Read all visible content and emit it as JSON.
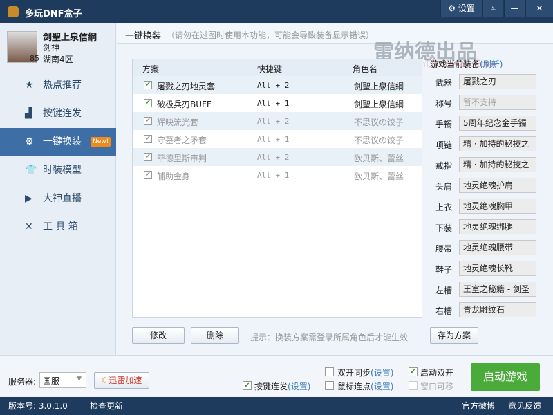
{
  "app": {
    "title": "多玩DNF盒子",
    "settings": "设置"
  },
  "profile": {
    "name": "剑聖上泉信綱",
    "class": "剑神",
    "server": "湖南4区",
    "level": "85"
  },
  "nav": [
    {
      "label": "热点推荐",
      "icon": "★"
    },
    {
      "label": "按键连发",
      "icon": "▟"
    },
    {
      "label": "一键换装",
      "icon": "⚙",
      "badge": "New!"
    },
    {
      "label": "时装模型",
      "icon": "👕"
    },
    {
      "label": "大神直播",
      "icon": "▶"
    },
    {
      "label": "工 具 箱",
      "icon": "✕"
    }
  ],
  "header": {
    "title": "一键换装",
    "note": "（请勿在过图时使用本功能，可能会导致装备显示错误）"
  },
  "watermark": {
    "main": "雷纳德出品",
    "url": "Dnf.Ddowan.Com"
  },
  "table": {
    "headers": [
      "方案",
      "快捷键",
      "角色名"
    ],
    "rows": [
      {
        "name": "屠戮之刃地灵套",
        "key": "Alt + 2",
        "role": "剑聖上泉信綱"
      },
      {
        "name": "破极兵刃BUFF",
        "key": "Alt + 1",
        "role": "剑聖上泉信綱"
      },
      {
        "name": "辉映流光套",
        "key": "Alt + 2",
        "role": "不思议の饺子"
      },
      {
        "name": "守墓者之矛套",
        "key": "Alt + 1",
        "role": "不思议の饺子"
      },
      {
        "name": "菲德里斯审判",
        "key": "Alt + 2",
        "role": "欧贝斯、蕾丝"
      },
      {
        "name": "辅助金身",
        "key": "Alt + 1",
        "role": "欧贝斯、蕾丝"
      }
    ]
  },
  "actions": {
    "edit": "修改",
    "delete": "删除",
    "tip": "提示：换装方案需登录所属角色后才能生效",
    "save": "存为方案"
  },
  "equip": {
    "title": "游戏当前装备",
    "refresh": "(刷新)",
    "items": [
      {
        "slot": "武器",
        "value": "屠戮之刃"
      },
      {
        "slot": "称号",
        "value": "暂不支持"
      },
      {
        "slot": "手镯",
        "value": "5周年纪念金手镯"
      },
      {
        "slot": "项链",
        "value": "精 · 加持的秘技之"
      },
      {
        "slot": "戒指",
        "value": "精 · 加持的秘技之"
      },
      {
        "slot": "头肩",
        "value": "地灵绝魂护肩"
      },
      {
        "slot": "上衣",
        "value": "地灵绝魂胸甲"
      },
      {
        "slot": "下装",
        "value": "地灵绝魂绑腿"
      },
      {
        "slot": "腰带",
        "value": "地灵绝魂腰带"
      },
      {
        "slot": "鞋子",
        "value": "地灵绝魂长靴"
      },
      {
        "slot": "左槽",
        "value": "王室之秘籍 - 剑圣"
      },
      {
        "slot": "右槽",
        "value": "青龙雕纹石"
      }
    ]
  },
  "bottom": {
    "server_label": "服务器:",
    "server": "国服",
    "xunlei": "迅雷加速",
    "keyrepeat": "按键连发",
    "set": "(设置)",
    "dualsync": "双开同步",
    "mouseclick": "鼠标连点",
    "dualopen": "启动双开",
    "movable": "窗口可移",
    "start": "启动游戏"
  },
  "status": {
    "version": "版本号: 3.0.1.0",
    "update": "检查更新",
    "weibo": "官方微博",
    "feedback": "意见反馈"
  }
}
